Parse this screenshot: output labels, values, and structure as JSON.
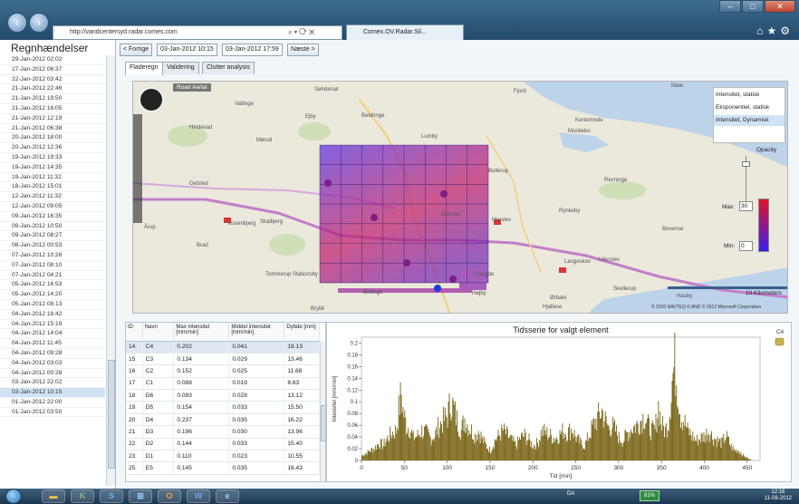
{
  "browser": {
    "address": "http://vandcentersyd.radar.comes.com",
    "tab_title": "Comex.OV.Radar.Sil...",
    "colors": {
      "titlebar": "#2e5677"
    }
  },
  "sidebar": {
    "title": "Regnhændelser",
    "items": [
      "29-Jan-2012 02:02",
      "27-Jan-2012 06:37",
      "22-Jan-2012 03:42",
      "21-Jan-2012 22:46",
      "21-Jan-2012 19:50",
      "21-Jan-2012 16:05",
      "21-Jan-2012 12:19",
      "21-Jan-2012 06:38",
      "20-Jan-2012 18:00",
      "20-Jan-2012 12:36",
      "19-Jan-2012 19:33",
      "19-Jan-2012 14:35",
      "19-Jan-2012 11:32",
      "18-Jan-2012 15:01",
      "12-Jan-2012 11:32",
      "12-Jan-2012 09:05",
      "09-Jan-2012 16:35",
      "09-Jan-2012 10:50",
      "09-Jan-2012 08:27",
      "08-Jan-2012 00:53",
      "07-Jan-2012 10:26",
      "07-Jan-2012 08:10",
      "07-Jan-2012 04:21",
      "05-Jan-2012 16:53",
      "05-Jan-2012 14:20",
      "05-Jan-2012 08:13",
      "04-Jan-2012 18:42",
      "04-Jan-2012 15:19",
      "04-Jan-2012 14:04",
      "04-Jan-2012 11:45",
      "04-Jan-2012 09:28",
      "04-Jan-2012 03:03",
      "04-Jan-2012 00:28",
      "03-Jan-2012 22:02",
      "03-Jan-2012 10:15",
      "01-Jan-2012 22:00",
      "01-Jan-2012 03:50"
    ],
    "selected_index": 34
  },
  "toolbar": {
    "prev_label": "< Forrige",
    "start_time": "03-Jan-2012 10:15",
    "end_time": "03-Jan-2012 17:59",
    "next_label": "Næste >"
  },
  "tabs": [
    "Fladeregn",
    "Validering",
    "Clutter analysis"
  ],
  "map": {
    "mode_road": "Road",
    "mode_aerial": "Aerial",
    "layers": [
      "Intensitet, statisk",
      "Eksponentiel, statisk",
      "Intensitet, Dynamisk"
    ],
    "selected_layer": 2,
    "opacity_label": "Opacity",
    "max_label": "Max:",
    "max_value": "30",
    "min_label": "Min:",
    "min_value": "0",
    "scale": "10 Kilometers",
    "copyright": "© 2010 NAVTEQ  © AND  © 2012 Microsoft Corporation",
    "places": [
      {
        "name": "Søndersø"
      },
      {
        "name": "Vallinge"
      },
      {
        "name": "Beldringe"
      },
      {
        "name": "Hindevad"
      },
      {
        "name": "Mørud"
      },
      {
        "name": "Ejby"
      },
      {
        "name": "Lumby"
      },
      {
        "name": "Bullerup"
      },
      {
        "name": "Kerteminde"
      },
      {
        "name": "Munkebo"
      },
      {
        "name": "Revninge"
      },
      {
        "name": "Gelsted"
      },
      {
        "name": "Odense"
      },
      {
        "name": "Marslev"
      },
      {
        "name": "Rynkeby"
      },
      {
        "name": "Vissenbjerg"
      },
      {
        "name": "Skalbjerg"
      },
      {
        "name": "Bovense"
      },
      {
        "name": "Årup"
      },
      {
        "name": "Brad"
      },
      {
        "name": "Tommerup Stationsby"
      },
      {
        "name": "Langeskov"
      },
      {
        "name": "Ullerslev"
      },
      {
        "name": "Højby"
      },
      {
        "name": "Bellinge"
      },
      {
        "name": "Fraugde"
      },
      {
        "name": "Skellerup"
      },
      {
        "name": "Ørbæk"
      },
      {
        "name": "Bryllé"
      },
      {
        "name": "Hjallese"
      },
      {
        "name": "Hauby"
      },
      {
        "name": "Fjord"
      },
      {
        "name": "Male"
      }
    ]
  },
  "table": {
    "headers": [
      "ID",
      "Navn",
      "Max intensitet [mm/min]",
      "Middel intensitet [mm/min]",
      "Dybde [mm]"
    ],
    "rows": [
      [
        "14",
        "C4",
        "0.202",
        "0.041",
        "19.13"
      ],
      [
        "15",
        "C3",
        "0.134",
        "0.029",
        "13.46"
      ],
      [
        "16",
        "C2",
        "0.152",
        "0.025",
        "11.68"
      ],
      [
        "17",
        "C1",
        "0.088",
        "0.019",
        "8.63"
      ],
      [
        "18",
        "D6",
        "0.093",
        "0.028",
        "13.12"
      ],
      [
        "19",
        "D5",
        "0.154",
        "0.033",
        "15.50"
      ],
      [
        "20",
        "D4",
        "0.237",
        "0.035",
        "16.22"
      ],
      [
        "21",
        "D3",
        "0.196",
        "0.030",
        "13.96"
      ],
      [
        "22",
        "D2",
        "0.144",
        "0.033",
        "15.40"
      ],
      [
        "23",
        "D1",
        "0.110",
        "0.023",
        "10.55"
      ],
      [
        "25",
        "E5",
        "0.145",
        "0.035",
        "16.43"
      ]
    ],
    "selected_index": 0
  },
  "chart_data": {
    "type": "bar",
    "title": "Tidsserie for valgt element",
    "xlabel": "Tid [min]",
    "ylabel": "Intensitet [mm/min]",
    "xlim": [
      0,
      465
    ],
    "ylim": [
      0,
      0.21
    ],
    "xticks": [
      0,
      50,
      100,
      150,
      200,
      250,
      300,
      350,
      400,
      450
    ],
    "yticks": [
      0,
      0.02,
      0.04,
      0.06,
      0.08,
      0.1,
      0.12,
      0.14,
      0.16,
      0.18,
      0.2
    ],
    "legend": "C4",
    "color": "#7d6a1e",
    "series": [
      {
        "name": "C4",
        "points": [
          [
            0,
            0.01
          ],
          [
            5,
            0.015
          ],
          [
            10,
            0.02
          ],
          [
            15,
            0.025
          ],
          [
            20,
            0.035
          ],
          [
            25,
            0.03
          ],
          [
            30,
            0.045
          ],
          [
            35,
            0.055
          ],
          [
            40,
            0.06
          ],
          [
            43,
            0.1
          ],
          [
            46,
            0.135
          ],
          [
            48,
            0.1
          ],
          [
            52,
            0.07
          ],
          [
            56,
            0.065
          ],
          [
            60,
            0.045
          ],
          [
            65,
            0.05
          ],
          [
            70,
            0.06
          ],
          [
            75,
            0.055
          ],
          [
            80,
            0.045
          ],
          [
            85,
            0.05
          ],
          [
            90,
            0.07
          ],
          [
            95,
            0.08
          ],
          [
            100,
            0.09
          ],
          [
            104,
            0.12
          ],
          [
            108,
            0.1
          ],
          [
            112,
            0.075
          ],
          [
            116,
            0.06
          ],
          [
            120,
            0.085
          ],
          [
            124,
            0.07
          ],
          [
            128,
            0.06
          ],
          [
            132,
            0.05
          ],
          [
            136,
            0.06
          ],
          [
            140,
            0.045
          ],
          [
            145,
            0.03
          ],
          [
            150,
            0.02
          ],
          [
            155,
            0.04
          ],
          [
            160,
            0.05
          ],
          [
            165,
            0.06
          ],
          [
            170,
            0.05
          ],
          [
            175,
            0.04
          ],
          [
            180,
            0.03
          ],
          [
            185,
            0.045
          ],
          [
            190,
            0.05
          ],
          [
            195,
            0.04
          ],
          [
            200,
            0.03
          ],
          [
            205,
            0.035
          ],
          [
            210,
            0.06
          ],
          [
            215,
            0.055
          ],
          [
            220,
            0.05
          ],
          [
            225,
            0.045
          ],
          [
            230,
            0.05
          ],
          [
            235,
            0.06
          ],
          [
            240,
            0.055
          ],
          [
            245,
            0.065
          ],
          [
            250,
            0.045
          ],
          [
            255,
            0.035
          ],
          [
            260,
            0.03
          ],
          [
            265,
            0.05
          ],
          [
            270,
            0.07
          ],
          [
            275,
            0.085
          ],
          [
            280,
            0.1
          ],
          [
            284,
            0.08
          ],
          [
            288,
            0.065
          ],
          [
            292,
            0.07
          ],
          [
            296,
            0.06
          ],
          [
            300,
            0.045
          ],
          [
            305,
            0.04
          ],
          [
            310,
            0.055
          ],
          [
            315,
            0.065
          ],
          [
            320,
            0.07
          ],
          [
            325,
            0.08
          ],
          [
            330,
            0.09
          ],
          [
            334,
            0.07
          ],
          [
            338,
            0.06
          ],
          [
            342,
            0.06
          ],
          [
            346,
            0.11
          ],
          [
            350,
            0.07
          ],
          [
            354,
            0.06
          ],
          [
            358,
            0.08
          ],
          [
            362,
            0.16
          ],
          [
            365,
            0.195
          ],
          [
            368,
            0.155
          ],
          [
            372,
            0.09
          ],
          [
            376,
            0.08
          ],
          [
            380,
            0.06
          ],
          [
            385,
            0.05
          ],
          [
            390,
            0.04
          ],
          [
            395,
            0.045
          ],
          [
            400,
            0.05
          ],
          [
            405,
            0.06
          ],
          [
            410,
            0.045
          ],
          [
            415,
            0.04
          ],
          [
            420,
            0.035
          ],
          [
            425,
            0.05
          ],
          [
            430,
            0.03
          ],
          [
            435,
            0.02
          ],
          [
            440,
            0.02
          ],
          [
            445,
            0.01
          ],
          [
            450,
            0.005
          ],
          [
            455,
            0.0
          ]
        ]
      }
    ]
  },
  "taskbar": {
    "time": "12:16",
    "date": "11-08-2012",
    "lang": "DA",
    "battery": "81%"
  }
}
